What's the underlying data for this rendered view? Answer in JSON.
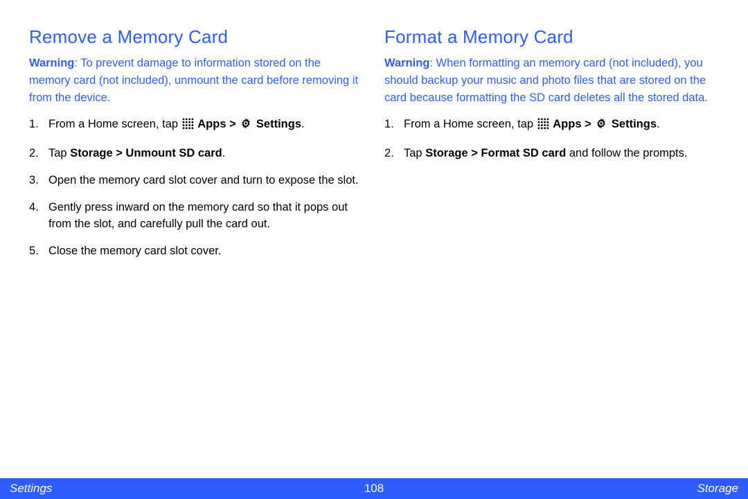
{
  "left": {
    "heading": "Remove a Memory Card",
    "warning_label": "Warning",
    "warning_text": ": To prevent damage to information stored on the memory card (not included), unmount the card before removing it from the device.",
    "steps": {
      "s1_prefix": "From a Home screen, tap ",
      "s1_apps": "Apps > ",
      "s1_settings": "Settings",
      "s1_suffix": ".",
      "s2_prefix": "Tap ",
      "s2_bold": "Storage > Unmount SD card",
      "s2_suffix": ".",
      "s3": "Open the memory card slot cover and turn to expose the slot.",
      "s4": "Gently press inward on the memory card so that it pops out from the slot, and carefully pull the card out.",
      "s5": "Close the memory card slot cover."
    }
  },
  "right": {
    "heading": "Format a Memory Card",
    "warning_label": "Warning",
    "warning_text": ": When formatting an memory card (not included), you should backup your music and photo files that are stored on the card because formatting the SD card deletes all the stored data.",
    "steps": {
      "s1_prefix": "From a Home screen, tap ",
      "s1_apps": "Apps > ",
      "s1_settings": "Settings",
      "s1_suffix": ".",
      "s2_prefix": "Tap ",
      "s2_bold": "Storage > Format SD card",
      "s2_suffix": " and follow the prompts."
    }
  },
  "footer": {
    "left": "Settings",
    "center": "108",
    "right": "Storage"
  }
}
